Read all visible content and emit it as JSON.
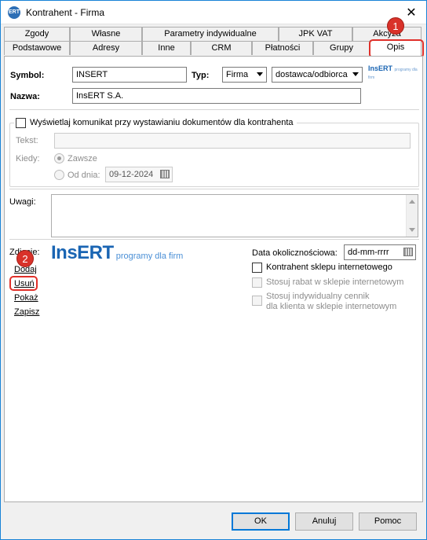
{
  "window": {
    "title": "Kontrahent - Firma",
    "app_icon_text": "ERT",
    "close_glyph": "✕"
  },
  "tabs": {
    "row1": [
      "Zgody",
      "Własne",
      "Parametry indywidualne",
      "JPK VAT",
      "Akcyza"
    ],
    "row2": [
      "Podstawowe",
      "Adresy",
      "Inne",
      "CRM",
      "Płatności",
      "Grupy",
      "Opis"
    ],
    "active": "Opis"
  },
  "form": {
    "symbol_label": "Symbol:",
    "symbol_value": "INSERT",
    "typ_label": "Typ:",
    "typ_value": "Firma",
    "role_value": "dostawca/odbiorca",
    "nazwa_label": "Nazwa:",
    "nazwa_value": "InsERT S.A.",
    "small_logo": "InsERT",
    "small_logo_tagline": "programy dla firm"
  },
  "message": {
    "checkbox_label": "Wyświetlaj komunikat przy wystawianiu dokumentów dla kontrahenta",
    "tekst_label": "Tekst:",
    "tekst_value": "",
    "kiedy_label": "Kiedy:",
    "zawsze_label": "Zawsze",
    "od_dnia_label": "Od dnia:",
    "od_dnia_value": "09-12-2024"
  },
  "uwagi": {
    "label": "Uwagi:",
    "value": ""
  },
  "photo": {
    "label": "Zdjęcie:",
    "logo_text": "InsERT",
    "logo_tagline": "programy dla firm",
    "actions": [
      "Dodaj",
      "Usuń",
      "Pokaż",
      "Zapisz"
    ]
  },
  "right_panel": {
    "date_label": "Data okolicznościowa:",
    "date_placeholder": "dd-mm-rrrr",
    "sklep_label": "Kontrahent sklepu internetowego",
    "rabat_label": "Stosuj rabat w sklepie internetowym",
    "cennik_label_1": "Stosuj indywidualny cennik",
    "cennik_label_2": "dla klienta w sklepie internetowym"
  },
  "footer": {
    "ok_label": "OK",
    "cancel_label": "Anuluj",
    "help_label": "Pomoc"
  },
  "annotations": {
    "badge_1": "1",
    "badge_2": "2",
    "color": "#e0302a"
  },
  "colors": {
    "logo_blue": "#1a65b3",
    "accent": "#0078d7"
  }
}
